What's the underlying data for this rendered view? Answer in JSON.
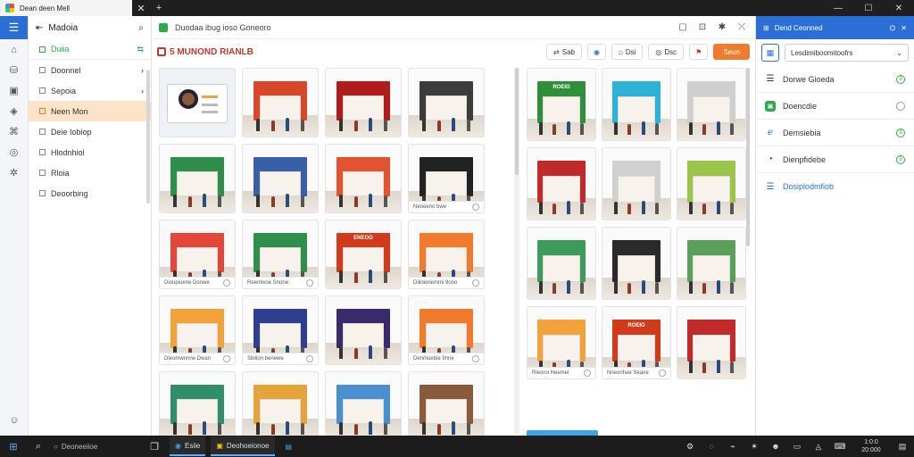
{
  "window": {
    "tab_title": "Dean deen Mell",
    "new_tab": "+",
    "controls": [
      "—",
      "☐",
      "✕"
    ]
  },
  "rail": {
    "icons": [
      "menu-icon",
      "home-icon",
      "cart-icon",
      "gallery-icon",
      "bag-icon",
      "shop-icon",
      "globe-icon",
      "settings-icon"
    ]
  },
  "sidebar": {
    "title": "Madoia",
    "items": [
      {
        "label": "Duiia",
        "active": false
      },
      {
        "label": "Doonnel",
        "active": false
      },
      {
        "label": "Sepoia",
        "active": false
      },
      {
        "label": "Neen Mon",
        "active": true
      },
      {
        "label": "Deie Iobiop",
        "active": false
      },
      {
        "label": "Hlodnhiol",
        "active": false
      },
      {
        "label": "Rloia",
        "active": false
      },
      {
        "label": "Deoorbing",
        "active": false
      }
    ]
  },
  "main": {
    "title": "Duodaa ibug ioso Goneoro",
    "brand": "5 MUNOND RIANLB",
    "toolbar": [
      {
        "label": "Sab"
      },
      {
        "label": ""
      },
      {
        "label": "Dsi"
      },
      {
        "label": "Dsc"
      },
      {
        "label": ""
      }
    ],
    "primary_button": "Seun",
    "left_cards": [
      {
        "type": "profile"
      },
      {
        "sign": "",
        "color": "#d9472b"
      },
      {
        "sign": "",
        "color": "#b11b1b"
      },
      {
        "sign": "",
        "color": "#3c3c3c"
      },
      {
        "sign": "",
        "color": "#2f8f4a"
      },
      {
        "sign": "",
        "color": "#3a5fa8"
      },
      {
        "sign": "",
        "color": "#e2542f"
      },
      {
        "sign": "",
        "color": "#222222",
        "caption": "Neoeeno bwe"
      },
      {
        "sign": "",
        "color": "#e4473a",
        "caption": "Dioupiuene Donwe"
      },
      {
        "sign": "",
        "color": "#2f8f4a",
        "caption": "Reentwoe Snone"
      },
      {
        "sign": "ENEOO",
        "color": "#d13a1a"
      },
      {
        "sign": "",
        "color": "#f07b2c",
        "caption": "Diiloeniemmi 9ono"
      },
      {
        "sign": "",
        "color": "#f2a23a",
        "caption": "Dleomwnnne Dwan"
      },
      {
        "sign": "",
        "color": "#2f3e8f",
        "caption": "Sbilion benewe"
      },
      {
        "sign": "",
        "color": "#3a2a6a"
      },
      {
        "sign": "",
        "color": "#f07b2c",
        "caption": "Denmuebie 9nne"
      },
      {
        "sign": "",
        "color": "#2f8f6a"
      },
      {
        "sign": "",
        "color": "#e5a43a"
      },
      {
        "sign": "",
        "color": "#4a90d0"
      },
      {
        "sign": "",
        "color": "#8a5a3c"
      }
    ],
    "right_cards": [
      {
        "sign": "ROEIO",
        "color": "#2f8f3a"
      },
      {
        "sign": "",
        "color": "#2bb2d6"
      },
      {
        "sign": "",
        "color": "#cfcfcf"
      },
      {
        "sign": "",
        "color": "#c02a2a"
      },
      {
        "sign": "",
        "color": "#d0d0d0"
      },
      {
        "sign": "",
        "color": "#9bc54a"
      },
      {
        "sign": "",
        "color": "#3c9a5a"
      },
      {
        "sign": "",
        "color": "#2a2a2a"
      },
      {
        "sign": "",
        "color": "#5aa05a"
      },
      {
        "sign": "",
        "color": "#f2a23a",
        "caption": "Rleoroi Heemei"
      },
      {
        "sign": "ROEIO",
        "color": "#d13a1a",
        "caption": "Nneonhae Seane"
      },
      {
        "sign": "",
        "color": "#c02a2a"
      }
    ]
  },
  "right_panel": {
    "header": "Dend Ceonned",
    "select_value": "Lesdimiboomitoofrs",
    "items": [
      {
        "label": "Dorwe Gioeda",
        "icon": "list-icon",
        "status": "9"
      },
      {
        "label": "Doencdie",
        "icon": "green-app-icon",
        "status": ""
      },
      {
        "label": "Demsiebia",
        "icon": "edge-icon",
        "status": "9"
      },
      {
        "label": "Dienpfidebe",
        "icon": "clock-icon",
        "status": "9"
      },
      {
        "label": "Dosiplodmfiob",
        "icon": "list-icon",
        "status": ""
      }
    ]
  },
  "taskbar": {
    "search_placeholder": "Deoneeiioe",
    "apps": [
      {
        "label": "Esiie",
        "active": true
      },
      {
        "label": "Deohoeionoe",
        "active": true
      },
      {
        "label": "",
        "active": false
      }
    ],
    "clock_time": "1:0:0",
    "clock_date": "20:000"
  },
  "colors": {
    "accent": "#2b6fd6",
    "primary_button": "#f07b2c",
    "active_sidebar": "#fde3c8"
  }
}
